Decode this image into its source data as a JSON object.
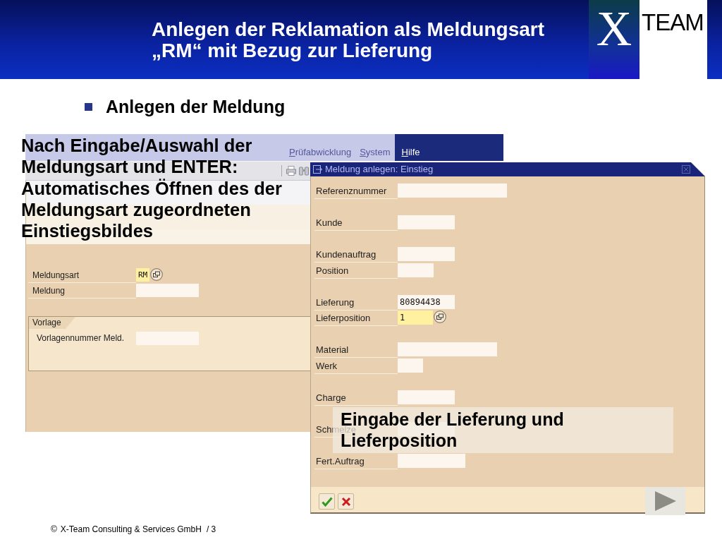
{
  "header": {
    "title": "Anlegen der Reklamation als Meldungsart „RM“ mit Bezug zur Lieferung",
    "logo": {
      "mark": "X",
      "word": "TEAM"
    }
  },
  "bullet": {
    "text": "Anlegen der Meldung"
  },
  "note": "Nach Eingabe/Auswahl der Meldungsart und ENTER: Automatisches Öffnen des der Meldungsart zugeordneten Einstiegsbildes",
  "background_window": {
    "menu": [
      {
        "label": "Prüfabwicklung",
        "selected": false
      },
      {
        "label": "System",
        "selected": false
      },
      {
        "label": "Hilfe",
        "selected": true
      }
    ],
    "fields": [
      {
        "label": "Meldungsart",
        "value": "RM",
        "focused": true,
        "value_help": true
      },
      {
        "label": "Meldung",
        "focused": false,
        "value_help": false
      }
    ],
    "group": {
      "title": "Vorlage",
      "fields": [
        {
          "label": "Vorlagennummer Meld.",
          "focused": false,
          "value_help": false
        }
      ]
    }
  },
  "dialog": {
    "title": "Meldung anlegen: Einstieg",
    "groups": [
      {
        "fields": [
          {
            "label": "Referenznummer",
            "focused": false,
            "value_help": false
          }
        ]
      },
      {
        "fields": [
          {
            "label": "Kunde",
            "focused": false,
            "value_help": false
          }
        ]
      },
      {
        "fields": [
          {
            "label": "Kundenauftrag",
            "focused": false,
            "value_help": false
          },
          {
            "label": "Position",
            "focused": false,
            "value_help": false
          }
        ]
      },
      {
        "fields": [
          {
            "label": "Lieferung",
            "value": "80894438",
            "focused": false,
            "value_help": false
          },
          {
            "label": "Lieferposition",
            "value": "1",
            "focused": true,
            "value_help": true
          }
        ]
      },
      {
        "fields": [
          {
            "label": "Material",
            "focused": false,
            "value_help": false
          },
          {
            "label": "Werk",
            "focused": false,
            "value_help": false
          }
        ]
      },
      {
        "fields": [
          {
            "label": "Charge",
            "focused": false,
            "value_help": false
          }
        ]
      },
      {
        "fields": [
          {
            "label": "Schmelze",
            "focused": false,
            "value_help": false
          }
        ]
      },
      {
        "fields": [
          {
            "label": "Fert.Auftrag",
            "focused": false,
            "value_help": false
          }
        ]
      }
    ]
  },
  "callout": "Eingabe der Lieferung und Lieferposition",
  "footer": {
    "copyright": "©",
    "text": "X-Team Consulting & Services GmbH",
    "page": "/ 3"
  }
}
